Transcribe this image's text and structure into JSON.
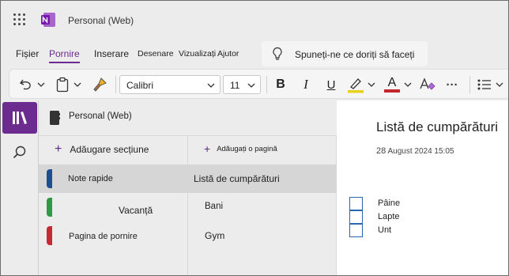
{
  "app": {
    "title": "Personal (Web)"
  },
  "menu": {
    "tabs": [
      {
        "label": "Fișier"
      },
      {
        "label": "Pornire"
      },
      {
        "label": "Inserare"
      },
      {
        "label": "Desenare"
      },
      {
        "label": "Vizualizați"
      },
      {
        "label": "Ajutor"
      }
    ],
    "active_tab": "Pornire",
    "tell_me": "Spuneți-ne ce doriți să faceți"
  },
  "ribbon": {
    "font_name": "Calibri",
    "font_size": "11",
    "bold": "B",
    "italic": "I",
    "underline": "U",
    "font_color_letter": "A",
    "more": "···",
    "highlight_color": "#e8d11b",
    "font_color": "#c4262e"
  },
  "notebook": {
    "title": "Personal (Web)"
  },
  "sections": {
    "add_label": "Adăugare secțiune",
    "items": [
      {
        "label": "Note rapide",
        "color": "#1e4d91"
      },
      {
        "label": "Vacanță",
        "color": "#2e9a46"
      },
      {
        "label": "Pagina de pornire",
        "color": "#c72836"
      }
    ]
  },
  "pages": {
    "add_label": "Adăugați o pagină",
    "items": [
      {
        "label": "Listă de cumpărături"
      },
      {
        "label": "Bani"
      },
      {
        "label": "Gym"
      }
    ]
  },
  "page": {
    "title": "Listă de cumpărături",
    "date_day": "28",
    "date_rest": "August 2024 15:05",
    "todos": [
      {
        "label": "Pâine"
      },
      {
        "label": "Lapte"
      },
      {
        "label": "Unt"
      }
    ]
  },
  "colors": {
    "accent": "#6b2b8f",
    "checkbox": "#2b67b0"
  }
}
